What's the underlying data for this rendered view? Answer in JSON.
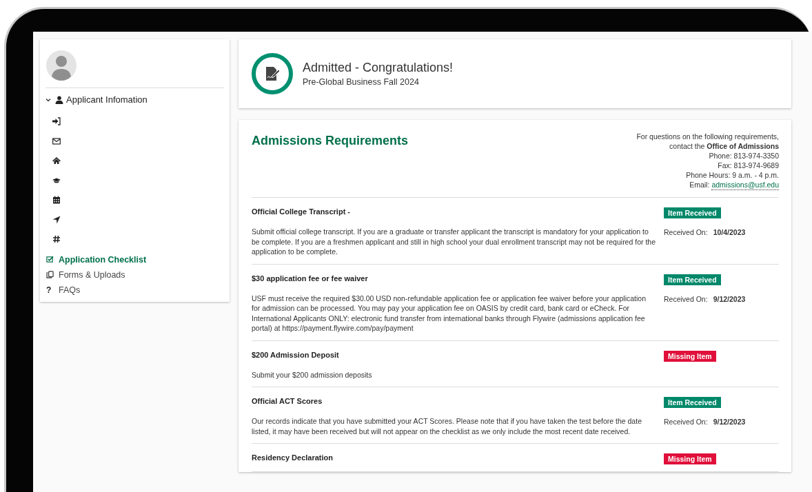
{
  "sidebar": {
    "section": {
      "label": "Applicant Infomation",
      "expanded": true,
      "children": [
        {
          "kind": "sign-in"
        },
        {
          "kind": "envelope"
        },
        {
          "kind": "home"
        },
        {
          "kind": "graduation"
        },
        {
          "kind": "calendar"
        },
        {
          "kind": "location-arrow"
        },
        {
          "kind": "hash"
        }
      ]
    },
    "items": [
      {
        "label": "Application Checklist",
        "kind": "checklist",
        "selected": true
      },
      {
        "label": "Forms & Uploads",
        "kind": "copy",
        "selected": false
      },
      {
        "label": "FAQs",
        "kind": "text",
        "icon": "?",
        "selected": false
      }
    ]
  },
  "status": {
    "title": "Admitted - Congratulations!",
    "subtitle": "Pre-Global Business Fall 2024"
  },
  "requirements": {
    "title": "Admissions Requirements",
    "contact": {
      "lines": [
        "For questions on the following requirements,",
        "contact the **Office of Admissions**",
        "Phone: 813-974-3350",
        "Fax: 813-974-9689",
        "Phone Hours: 9 a.m. - 4 p.m."
      ],
      "email_label": "Email:",
      "email": "admissions@usf.edu"
    },
    "rows": [
      {
        "title": "Official College Transcript -",
        "kind": "received",
        "badge": "Item Received",
        "description": "Submit official college transcript. If you are a graduate or transfer applicant the transcript is mandatory for your application to be complete.  If you are a freshmen applicant and still in high school your dual enrollment transcript may not be required for the application to be complete.",
        "received_label": "Received On:",
        "received_date": "10/4/2023"
      },
      {
        "title": "$30 application fee or fee waiver",
        "kind": "received",
        "badge": "Item Received",
        "description": "USF must receive the required $30.00 USD non-refundable application fee or application fee waiver before your application for admission can be processed. You may pay your application fee on OASIS by credit card, bank card or eCheck.  For International Applicants ONLY: electronic fund transfer from international banks through Flywire (admissions application fee portal) at https://payment.flywire.com/pay/payment",
        "received_label": "Received On:",
        "received_date": "9/12/2023"
      },
      {
        "title": "$200 Admission Deposit",
        "kind": "missing",
        "badge": "Missing Item",
        "description": "Submit your $200 admission deposits"
      },
      {
        "title": "Official ACT Scores",
        "kind": "received",
        "badge": "Item Received",
        "description": "Our records indicate that you have submitted your ACT Scores. Please note that if you have taken the test before the date listed, it may have been received but will not appear on the checklist as we only include the most recent date received.",
        "received_label": "Received On:",
        "received_date": "9/12/2023"
      },
      {
        "title": "Residency Declaration",
        "kind": "missing",
        "badge": "Missing Item"
      }
    ]
  }
}
